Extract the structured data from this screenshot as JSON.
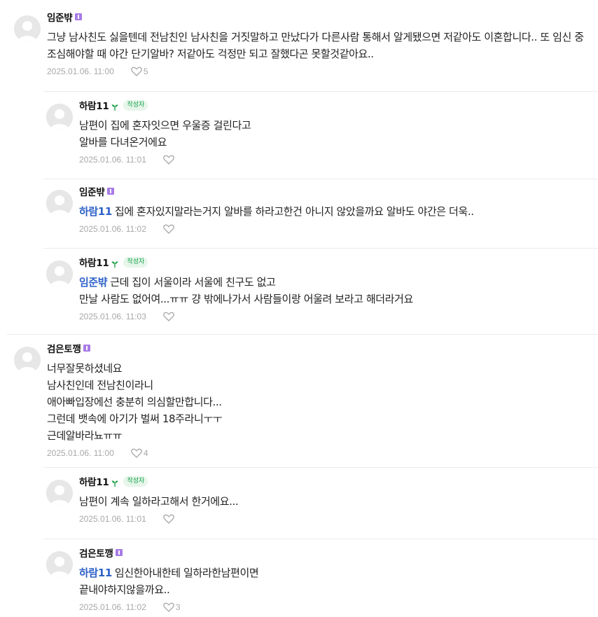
{
  "comments": [
    {
      "nickname": "임준뱎",
      "is_author": false,
      "mention": "",
      "text": "그냥 남사친도 싫을텐데 전남친인 남사친을 거짓말하고 만났다가 다른사람 통해서 알게됐으면 저같아도 이혼합니다.. 또 임신 중 조심해야할 때 야간 단기알바? 저같아도 걱정만 되고 잘했다곤 못할것같아요..",
      "date": "2025.01.06. 11:00",
      "likes": "5"
    },
    {
      "nickname": "하람11",
      "is_author": true,
      "author_badge": "작성자",
      "mention": "",
      "text": "남편이 집에 혼자잇으면 우울증 걸린다고\n알바를 다녀온거에요",
      "date": "2025.01.06. 11:01",
      "likes": ""
    },
    {
      "nickname": "임준뱎",
      "is_author": false,
      "mention": "하람11",
      "text": "집에 혼자있지말라는거지 알바를 하라고한건 아니지 않았을까요 알바도 야간은 더욱..",
      "date": "2025.01.06. 11:02",
      "likes": ""
    },
    {
      "nickname": "하람11",
      "is_author": true,
      "author_badge": "작성자",
      "mention": "임준뱎",
      "text": "근데 집이 서울이라 서울에 친구도 없고\n만날 사람도 없어여...ㅠㅠ 걍 밖에나가서 사람들이랑 어울려 보라고 해더라거요",
      "date": "2025.01.06. 11:03",
      "likes": ""
    },
    {
      "nickname": "검은토깽",
      "is_author": false,
      "mention": "",
      "text": "너무잘못하셨네요\n남사친인데 전남친이라니\n애아빠입장에선 충분히 의심할만합니다...\n그런데 뱃속에 아기가 벌써 18주라니ㅜㅜ\n근데알바라뇨ㅠㅠ",
      "date": "2025.01.06. 11:00",
      "likes": "4"
    },
    {
      "nickname": "하람11",
      "is_author": true,
      "author_badge": "작성자",
      "mention": "",
      "text": "남편이 계속 일하라고해서 한거에요...",
      "date": "2025.01.06. 11:01",
      "likes": ""
    },
    {
      "nickname": "검은토깽",
      "is_author": false,
      "mention": "하람11",
      "text": "임신한아내한테 일하라한남편이면\n끝내야하지않을까요..",
      "date": "2025.01.06. 11:02",
      "likes": "3"
    }
  ],
  "colors": {
    "mention": "#2f62c8",
    "author_badge_text": "#16a34a",
    "author_badge_bg": "#e6f6ea",
    "level_badge": "#a77be6",
    "meta": "#a8a8a8"
  },
  "icons": {
    "avatar": "default-avatar-icon",
    "like": "heart-outline-icon",
    "level": "level-badge-icon",
    "author_sprout": "sprout-icon"
  }
}
